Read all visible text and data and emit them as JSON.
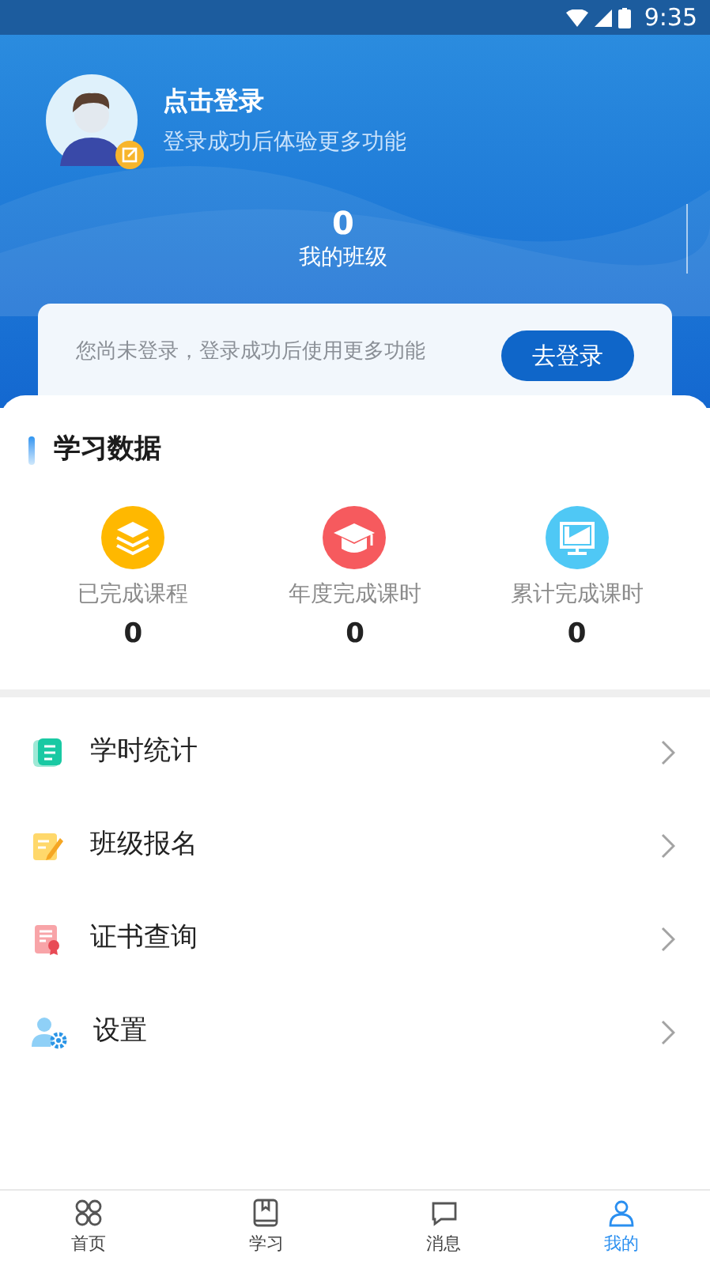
{
  "status_bar": {
    "time": "9:35"
  },
  "profile": {
    "title": "点击登录",
    "subtitle": "登录成功后体验更多功能"
  },
  "my_class": {
    "count": "0",
    "label": "我的班级"
  },
  "login_card": {
    "message": "您尚未登录，登录成功后使用更多功能",
    "button": "去登录"
  },
  "learning_data": {
    "title": "学习数据",
    "stats": [
      {
        "kind": "courses",
        "label": "已完成课程",
        "value": "0"
      },
      {
        "kind": "year",
        "label": "年度完成课时",
        "value": "0"
      },
      {
        "kind": "total",
        "label": "累计完成课时",
        "value": "0"
      }
    ]
  },
  "menu": [
    {
      "kind": "hours",
      "label": "学时统计"
    },
    {
      "kind": "signup",
      "label": "班级报名"
    },
    {
      "kind": "certificate",
      "label": "证书查询"
    },
    {
      "kind": "settings",
      "label": "设置"
    }
  ],
  "tab_bar": [
    {
      "kind": "home",
      "label": "首页",
      "selected": false
    },
    {
      "kind": "study",
      "label": "学习",
      "selected": false
    },
    {
      "kind": "messages",
      "label": "消息",
      "selected": false
    },
    {
      "kind": "mine",
      "label": "我的",
      "selected": true
    }
  ]
}
